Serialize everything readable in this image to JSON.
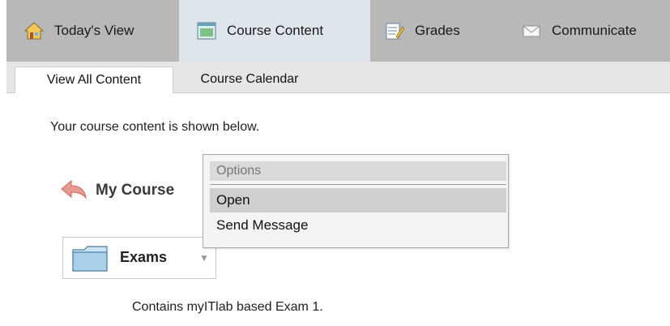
{
  "topnav": {
    "tabs": [
      {
        "label": "Today's View",
        "icon": "home-icon"
      },
      {
        "label": "Course Content",
        "icon": "course-content-icon"
      },
      {
        "label": "Grades",
        "icon": "grades-icon"
      },
      {
        "label": "Communicate",
        "icon": "envelope-icon"
      }
    ],
    "active": "Course Content"
  },
  "subtabs": [
    {
      "label": "View All Content"
    },
    {
      "label": "Course Calendar"
    }
  ],
  "intro": "Your course content is shown below.",
  "course": {
    "label": "My Course",
    "icon": "back-arrow-icon"
  },
  "context_menu": {
    "header": "Options",
    "items": [
      {
        "label": "Open"
      },
      {
        "label": "Send Message"
      }
    ]
  },
  "folder": {
    "name": "Exams",
    "description": "Contains myITlab based Exam 1.",
    "icon": "folder-icon"
  }
}
